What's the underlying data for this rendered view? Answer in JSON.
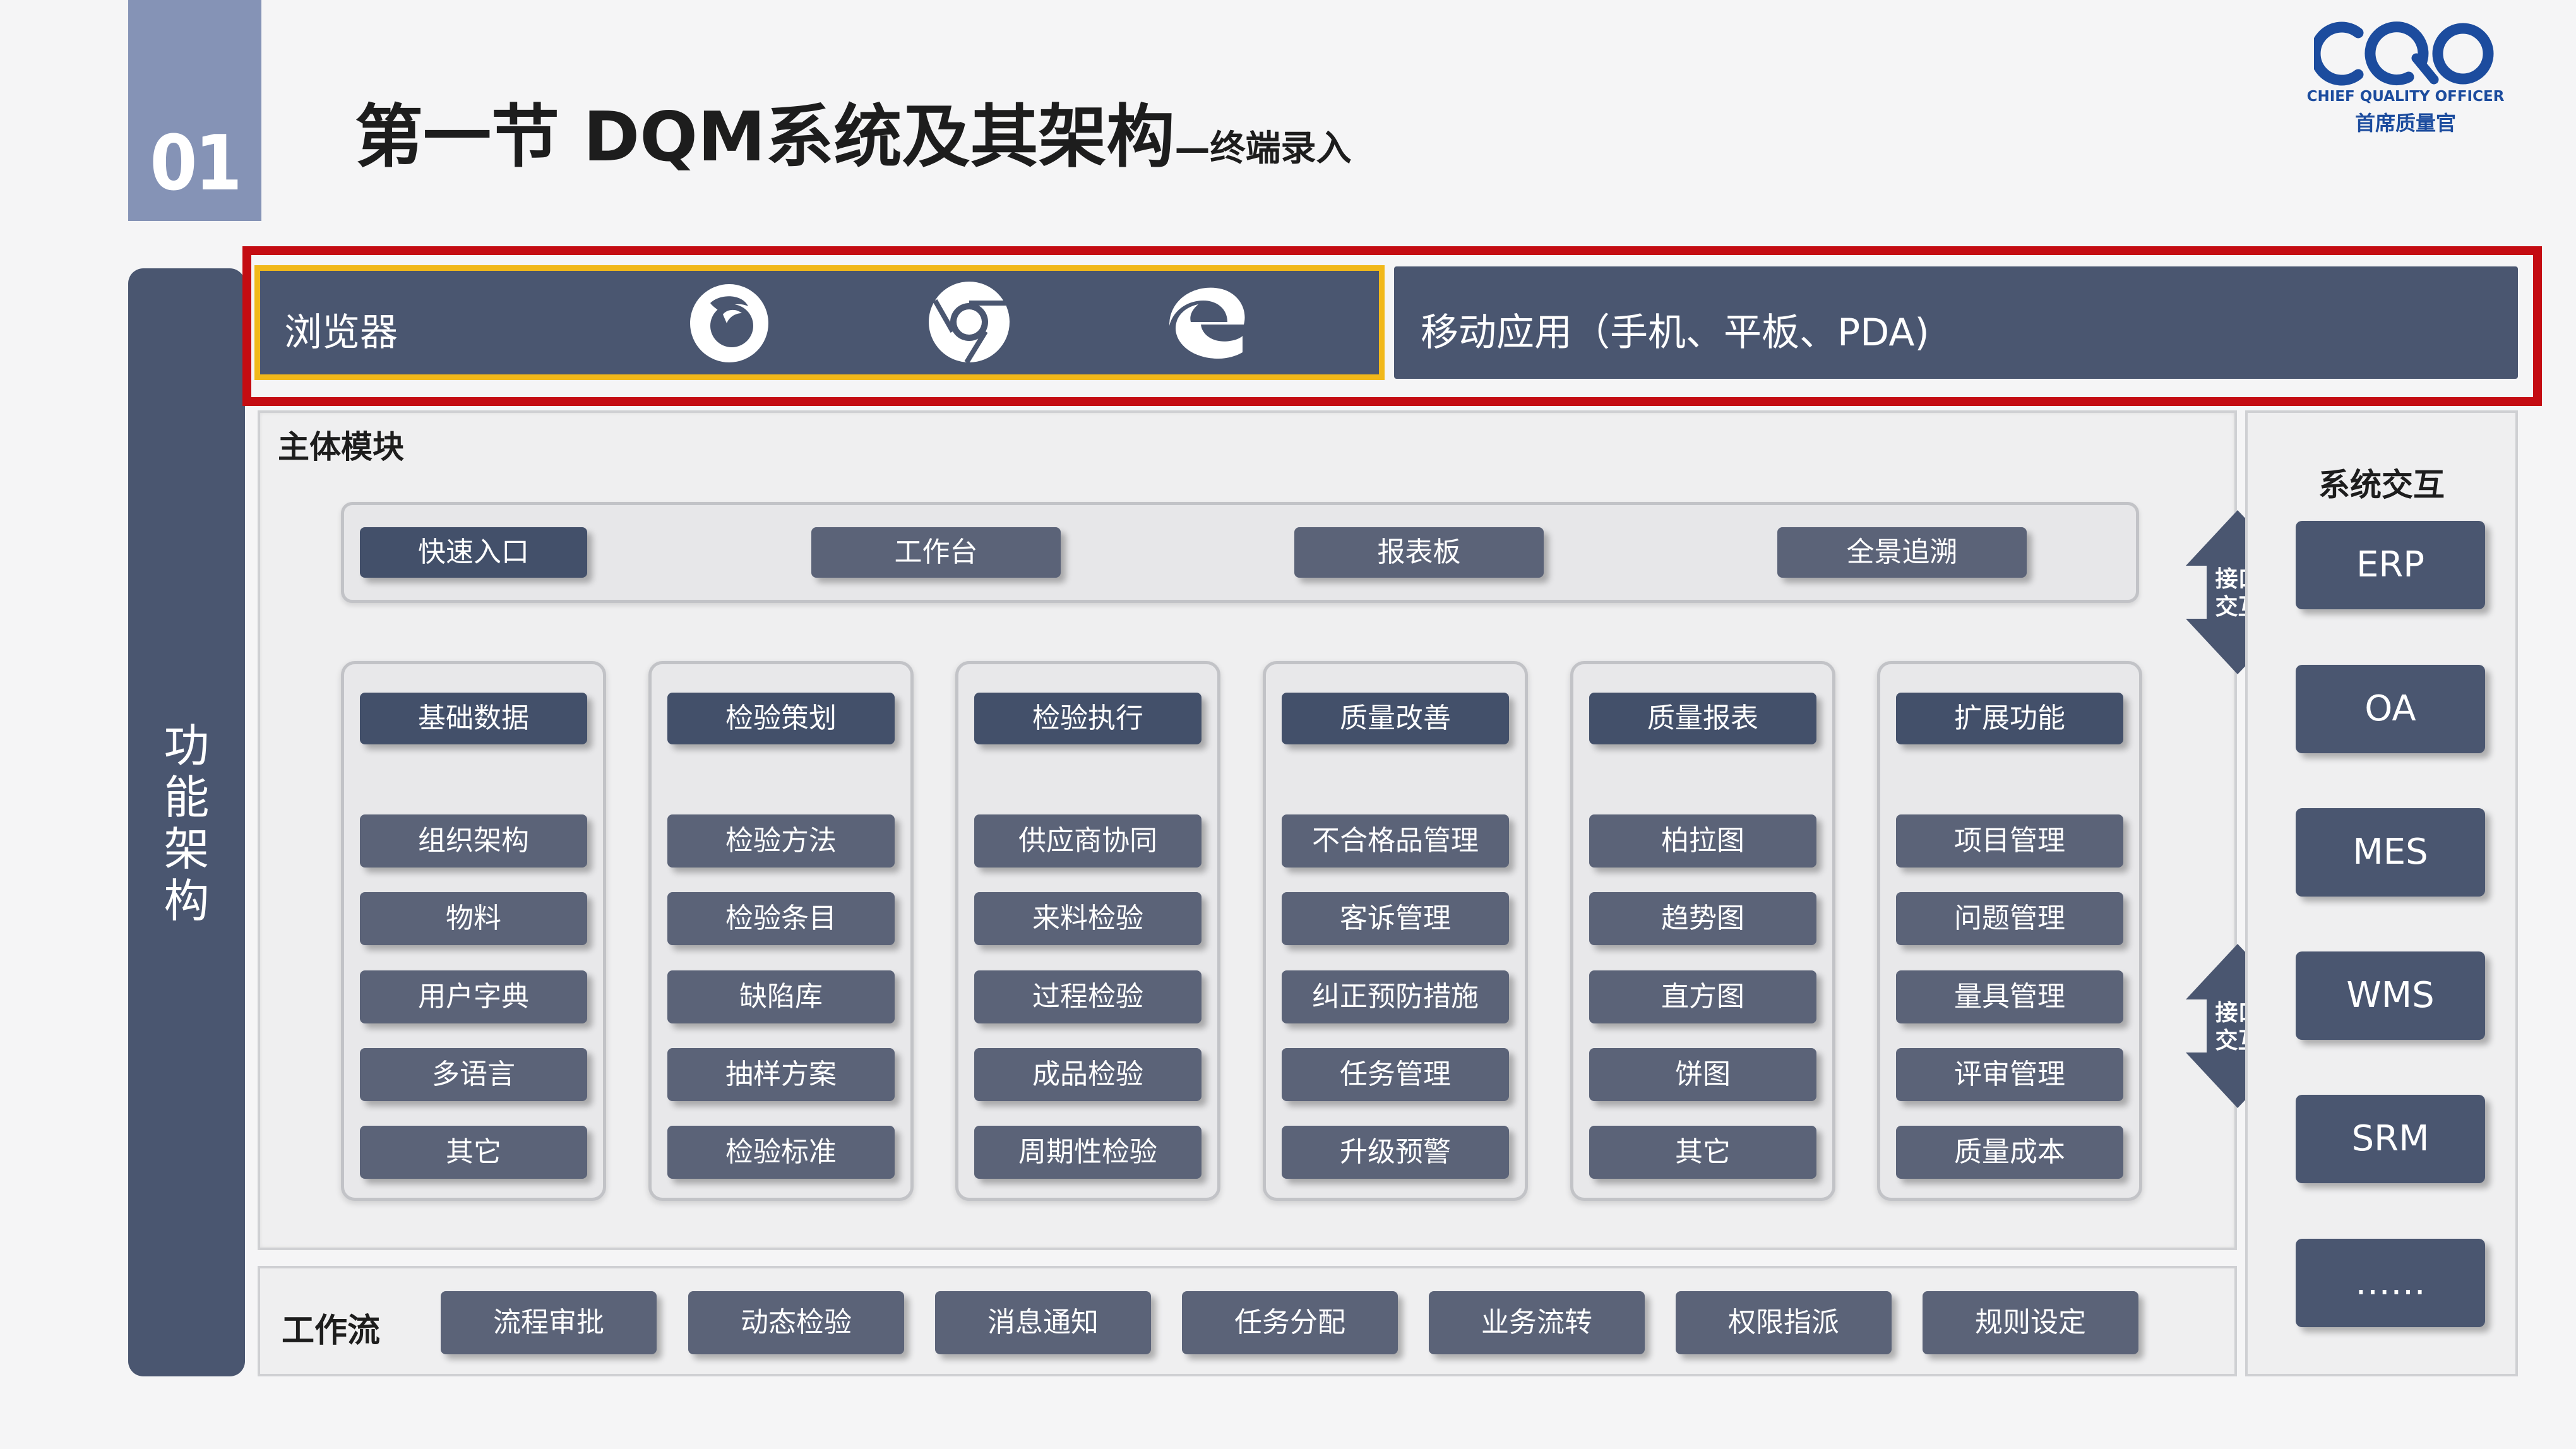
{
  "header": {
    "section_number": "01",
    "title": "第一节 DQM系统及其架构",
    "subtitle": "—终端录入"
  },
  "logo": {
    "mark": "CQO",
    "english": "CHIEF QUALITY OFFICER",
    "chinese": "首席质量官",
    "color": "#1c4c9e"
  },
  "left_label": "功能架构",
  "terminal": {
    "browser_label": "浏览器",
    "browser_icons": [
      "firefox-icon",
      "chrome-icon",
      "edge-icon"
    ],
    "mobile_label": "移动应用（手机、平板、PDA)",
    "highlight_color": "#c40c12",
    "browser_highlight_color": "#f1b81a"
  },
  "main": {
    "title": "主体模块",
    "quick_items": [
      "快速入口",
      "工作台",
      "报表板",
      "全景追溯"
    ],
    "columns": [
      {
        "header": "基础数据",
        "items": [
          "组织架构",
          "物料",
          "用户字典",
          "多语言",
          "其它"
        ]
      },
      {
        "header": "检验策划",
        "items": [
          "检验方法",
          "检验条目",
          "缺陷库",
          "抽样方案",
          "检验标准"
        ]
      },
      {
        "header": "检验执行",
        "items": [
          "供应商协同",
          "来料检验",
          "过程检验",
          "成品检验",
          "周期性检验"
        ]
      },
      {
        "header": "质量改善",
        "items": [
          "不合格品管理",
          "客诉管理",
          "纠正预防措施",
          "任务管理",
          "升级预警"
        ]
      },
      {
        "header": "质量报表",
        "items": [
          "柏拉图",
          "趋势图",
          "直方图",
          "饼图",
          "其它"
        ]
      },
      {
        "header": "扩展功能",
        "items": [
          "项目管理",
          "问题管理",
          "量具管理",
          "评审管理",
          "质量成本"
        ]
      }
    ]
  },
  "interfaces": [
    "接口交互",
    "接口交互"
  ],
  "system": {
    "title": "系统交互",
    "items": [
      "ERP",
      "OA",
      "MES",
      "WMS",
      "SRM",
      "……"
    ]
  },
  "workflow": {
    "title": "工作流",
    "items": [
      "流程审批",
      "动态检验",
      "消息通知",
      "任务分配",
      "业务流转",
      "权限指派",
      "规则设定"
    ]
  }
}
